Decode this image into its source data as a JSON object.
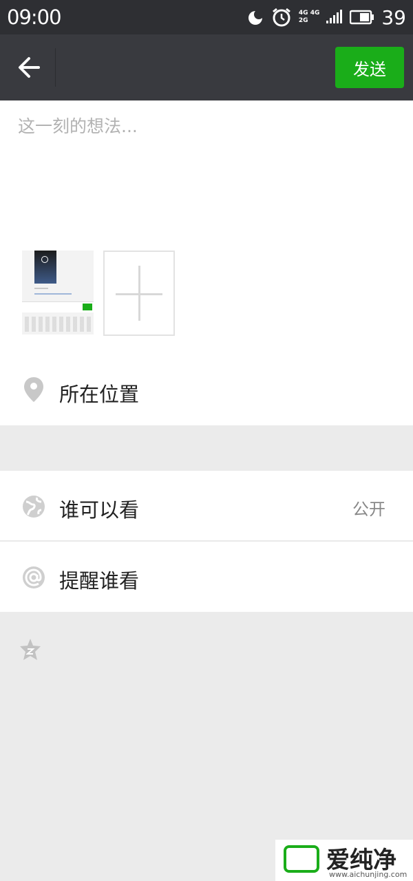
{
  "status_bar": {
    "time": "09:00",
    "battery": "39",
    "net_top": "4G 4G",
    "net_bottom": "2G"
  },
  "header": {
    "send_label": "发送"
  },
  "composer": {
    "placeholder": "这一刻的想法..."
  },
  "location": {
    "label": "所在位置",
    "icon": "location-pin-icon"
  },
  "visibility": {
    "label": "谁可以看",
    "value": "公开",
    "icon": "globe-icon"
  },
  "mention": {
    "label": "提醒谁看",
    "icon": "at-icon"
  },
  "qzone": {
    "icon": "qzone-star-icon"
  },
  "watermark": {
    "text": "爱纯净",
    "url": "www.aichunjing.com"
  },
  "colors": {
    "accent": "#1aad19",
    "header": "#393a3f",
    "statusbar": "#2e2f33",
    "background": "#ebebeb"
  }
}
